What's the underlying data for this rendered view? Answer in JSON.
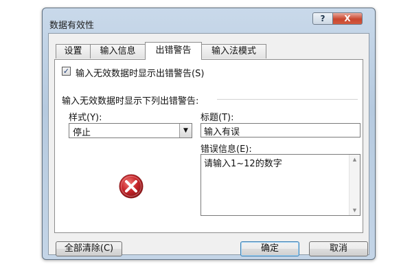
{
  "window": {
    "title": "数据有效性",
    "help_label": "?",
    "close_label": "X"
  },
  "tabs": [
    {
      "label": "设置",
      "active": false
    },
    {
      "label": "输入信息",
      "active": false
    },
    {
      "label": "出错警告",
      "active": true
    },
    {
      "label": "输入法模式",
      "active": false
    }
  ],
  "error_alert": {
    "show_alert_checkbox_label": "输入无效数据时显示出错警告(S)",
    "show_alert_checked": true,
    "checkbox_mark": "✓",
    "section_label": "输入无效数据时显示下列出错警告:",
    "style_label": "样式(Y):",
    "style_value": "停止",
    "dropdown_arrow": "▼",
    "title_label": "标题(T):",
    "title_value": "输入有误",
    "message_label": "错误信息(E):",
    "message_value": "请输入1~12的数字",
    "scroll_up": "▲",
    "scroll_down": "▼",
    "icon": "error-stop-icon"
  },
  "buttons": {
    "clear_all": "全部清除(C)",
    "ok": "确定",
    "cancel": "取消"
  },
  "colors": {
    "error_icon_red": "#c8262b",
    "default_button_border": "#3c7fb1",
    "close_button_red": "#c9462f"
  }
}
